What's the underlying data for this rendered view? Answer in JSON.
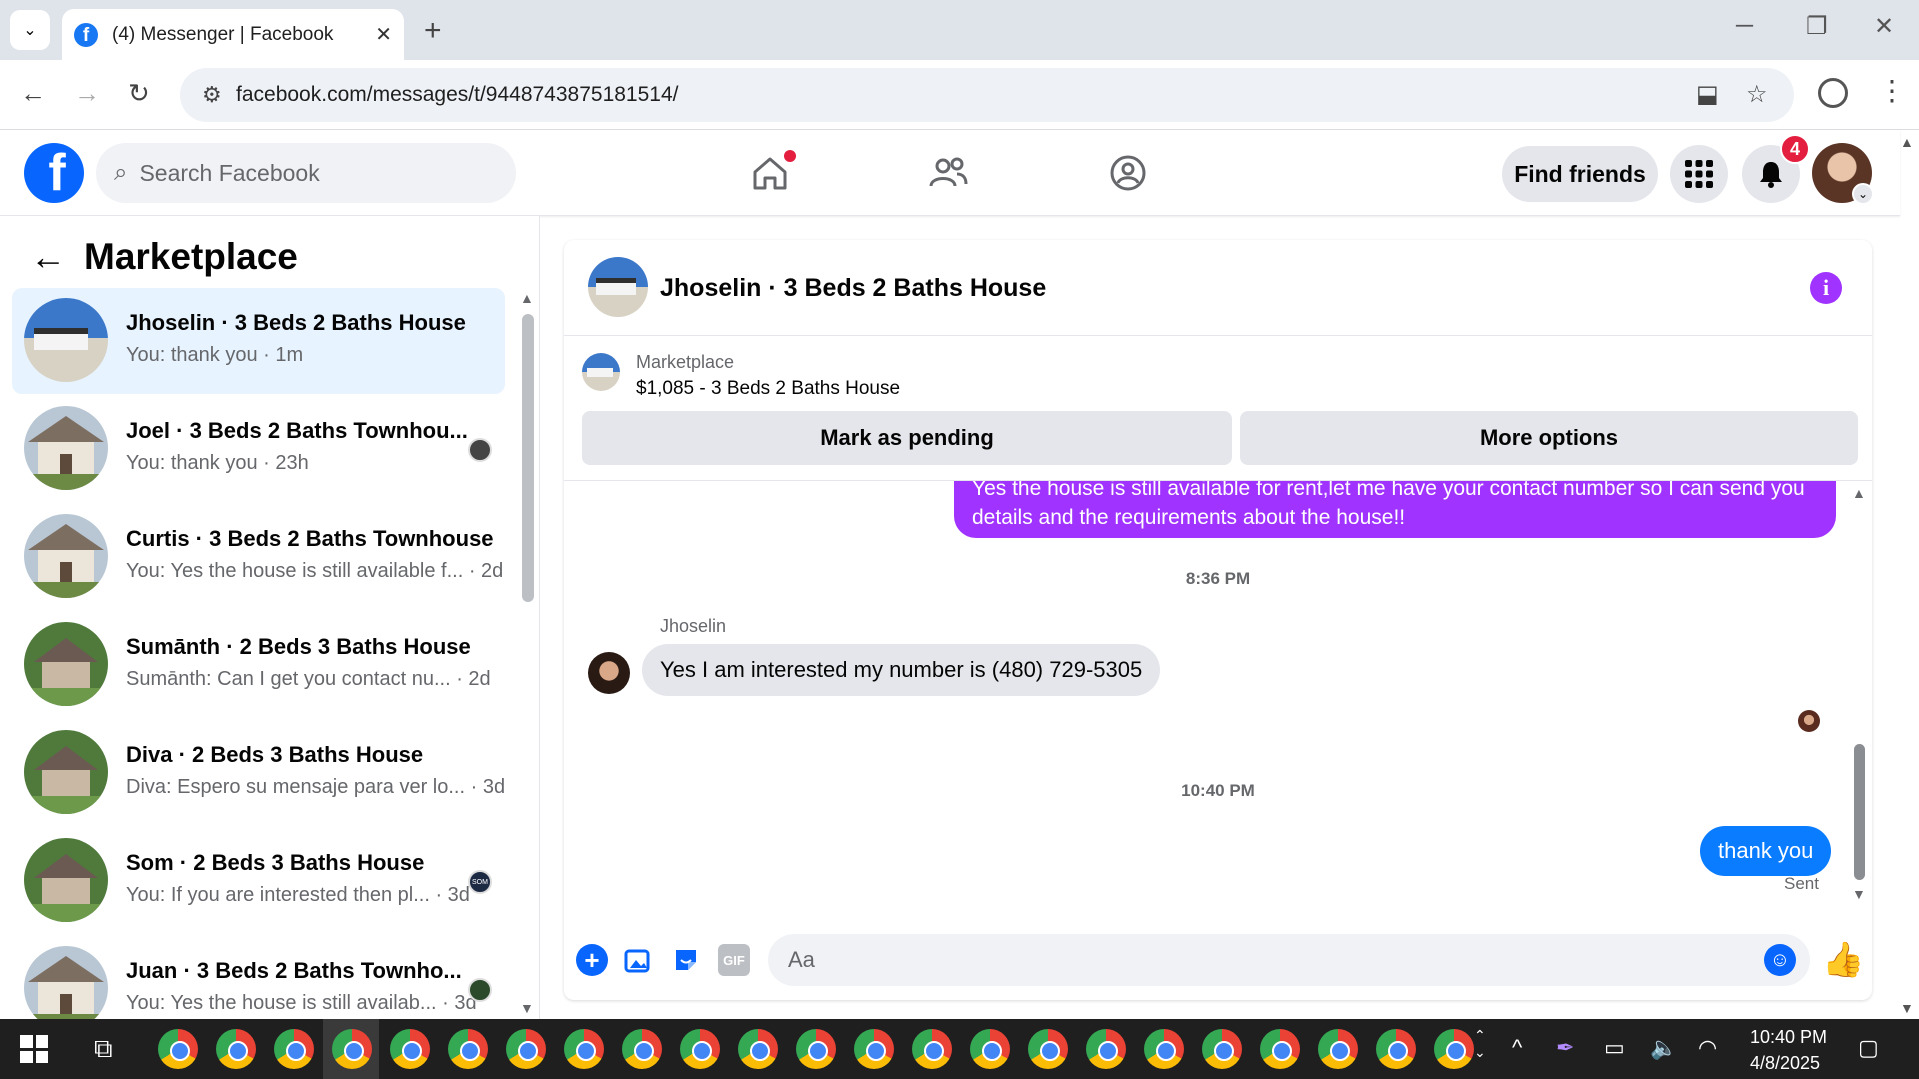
{
  "browser": {
    "tab_title": "(4) Messenger | Facebook",
    "url": "facebook.com/messages/t/9448743875181514/"
  },
  "fb_header": {
    "logo": "f",
    "search_placeholder": "Search Facebook",
    "find_friends": "Find friends",
    "notification_count": "4",
    "icons": [
      "home-icon",
      "friends-icon",
      "groups-icon",
      "menu-grid-icon",
      "bell-icon"
    ]
  },
  "sidebar": {
    "title": "Marketplace",
    "conversations": [
      {
        "name": "Jhoselin · 3 Beds 2 Baths House",
        "last": "You: thank you · 1m",
        "active": true
      },
      {
        "name": "Joel · 3 Beds 2 Baths Townhou...",
        "last": "You: thank you · 23h"
      },
      {
        "name": "Curtis · 3 Beds 2 Baths Townhouse",
        "last": "You: Yes the house is still available f... · 2d"
      },
      {
        "name": "Sumānth · 2 Beds 3 Baths House",
        "last": "Sumānth: Can I get you contact nu... · 2d"
      },
      {
        "name": "Diva · 2 Beds 3 Baths House",
        "last": "Diva: Espero su mensaje para ver lo... · 3d"
      },
      {
        "name": "Som · 2 Beds 3 Baths House",
        "last": "You: If you are interested then pl... · 3d"
      },
      {
        "name": "Juan · 3 Beds 2 Baths Townho...",
        "last": "You: Yes the house is still availab... · 3d"
      }
    ],
    "seen_som_label": "SOM"
  },
  "chat": {
    "title": "Jhoselin · 3 Beds 2 Baths House",
    "listing_source": "Marketplace",
    "listing_price": "$1,085 - 3 Beds 2 Baths House",
    "mark_pending": "Mark as pending",
    "more_options": "More options",
    "messages": {
      "outgoing_1": "Yes the house is still available for rent,let me have your contact number so I can send you details and the requirements about the house!!",
      "time_1": "8:36 PM",
      "sender": "Jhoselin",
      "incoming_1": "Yes I am interested my number is (480) 729-5305",
      "time_2": "10:40 PM",
      "outgoing_2": "thank you",
      "status": "Sent"
    },
    "composer_placeholder": "Aa",
    "gif_label": "GIF",
    "plus_label": "+"
  },
  "taskbar": {
    "time": "10:40 PM",
    "date": "4/8/2025"
  }
}
